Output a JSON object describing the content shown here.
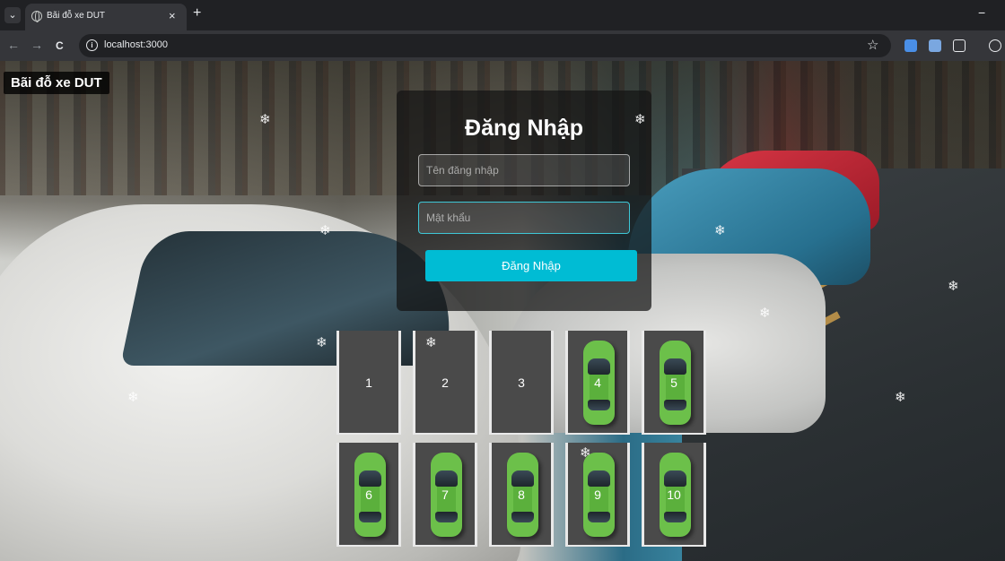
{
  "browser": {
    "tab_title": "Bãi đỗ xe DUT",
    "tab_close": "×",
    "new_tab": "+",
    "minimize": "−",
    "back": "←",
    "forward": "→",
    "reload": "C",
    "url": "localhost:3000",
    "star": "☆",
    "info_icon": "i"
  },
  "site": {
    "title": "Bãi đỗ xe DUT"
  },
  "login": {
    "title": "Đăng Nhập",
    "username_placeholder": "Tên đăng nhập",
    "password_placeholder": "Mật khẩu",
    "button_label": "Đăng Nhập"
  },
  "parking": {
    "slots": [
      {
        "number": "1",
        "occupied": false
      },
      {
        "number": "2",
        "occupied": false
      },
      {
        "number": "3",
        "occupied": false
      },
      {
        "number": "4",
        "occupied": true
      },
      {
        "number": "5",
        "occupied": true
      },
      {
        "number": "6",
        "occupied": true
      },
      {
        "number": "7",
        "occupied": true
      },
      {
        "number": "8",
        "occupied": true
      },
      {
        "number": "9",
        "occupied": true
      },
      {
        "number": "10",
        "occupied": true
      }
    ]
  },
  "decor": {
    "snowflake": "❄"
  },
  "colors": {
    "accent": "#00bcd4",
    "car": "#6cc04a",
    "slot": "#4a4a4a"
  }
}
